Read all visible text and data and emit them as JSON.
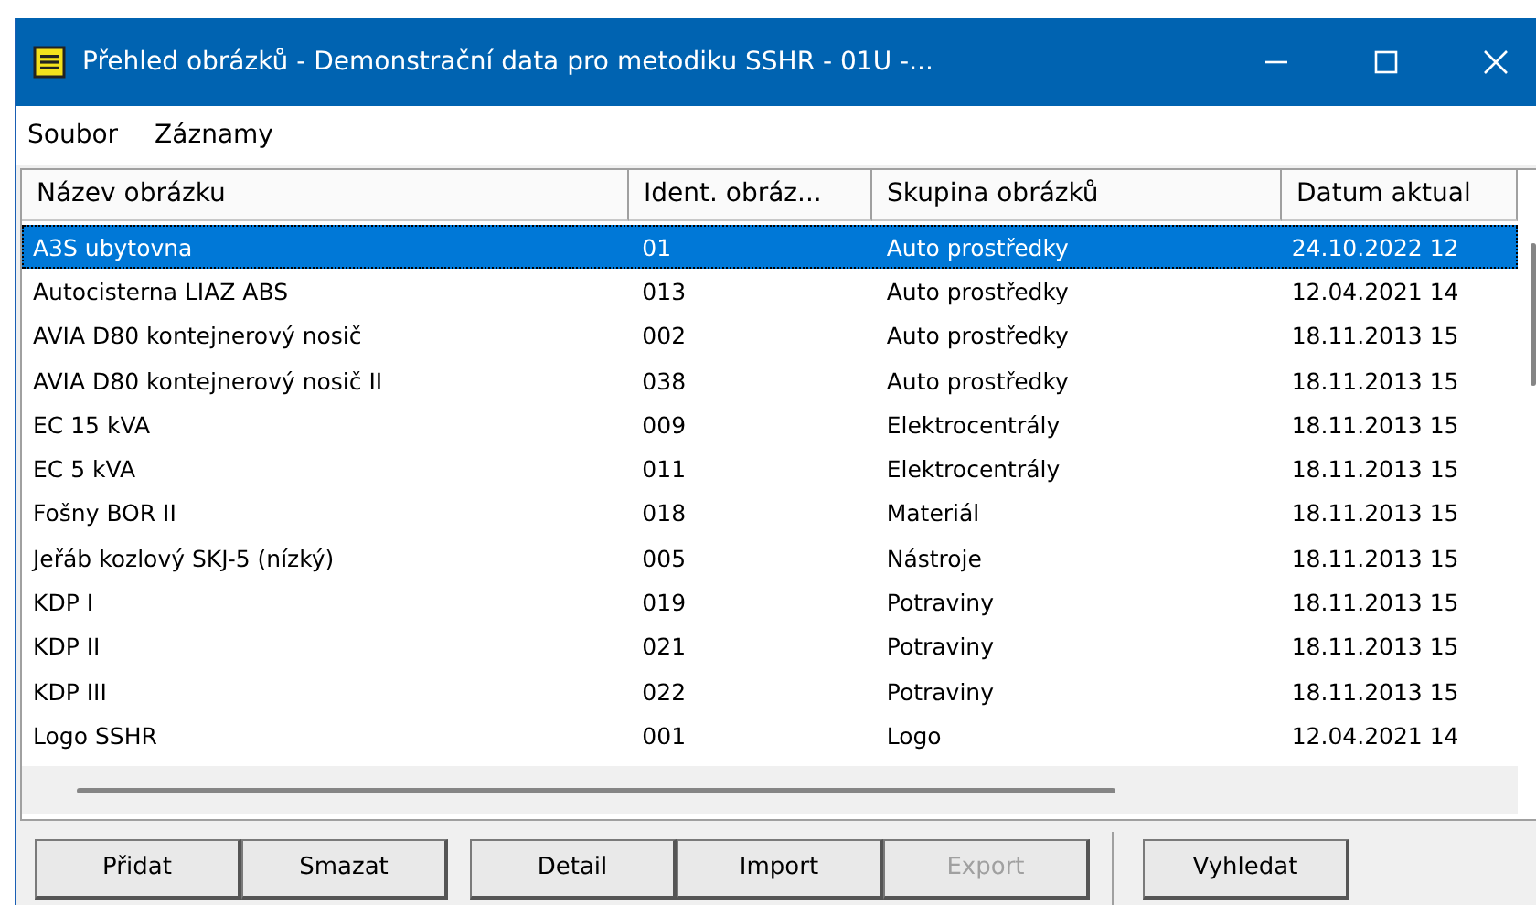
{
  "window": {
    "title": "Přehled obrázků - Demonstrační data pro metodiku SSHR - 01U -..."
  },
  "menu": [
    "Soubor",
    "Záznamy"
  ],
  "table": {
    "columns": [
      "Název obrázku",
      "Ident. obráz...",
      "Skupina obrázků",
      "Datum aktual"
    ],
    "rows": [
      {
        "cells": [
          "A3S ubytovna",
          "01",
          "Auto prostředky",
          "24.10.2022 12"
        ],
        "selected": true
      },
      {
        "cells": [
          "Autocisterna LIAZ ABS",
          "013",
          "Auto prostředky",
          "12.04.2021 14"
        ],
        "selected": false
      },
      {
        "cells": [
          "AVIA D80 kontejnerový nosič",
          "002",
          "Auto prostředky",
          "18.11.2013 15"
        ],
        "selected": false
      },
      {
        "cells": [
          "AVIA D80 kontejnerový nosič II",
          "038",
          "Auto prostředky",
          "18.11.2013 15"
        ],
        "selected": false
      },
      {
        "cells": [
          "EC 15 kVA",
          "009",
          "Elektrocentrály",
          "18.11.2013 15"
        ],
        "selected": false
      },
      {
        "cells": [
          "EC 5 kVA",
          "011",
          "Elektrocentrály",
          "18.11.2013 15"
        ],
        "selected": false
      },
      {
        "cells": [
          "Fošny BOR II",
          "018",
          "Materiál",
          "18.11.2013 15"
        ],
        "selected": false
      },
      {
        "cells": [
          "Jeřáb kozlový SKJ-5 (nízký)",
          "005",
          "Nástroje",
          "18.11.2013 15"
        ],
        "selected": false
      },
      {
        "cells": [
          "KDP I",
          "019",
          "Potraviny",
          "18.11.2013 15"
        ],
        "selected": false
      },
      {
        "cells": [
          "KDP II",
          "021",
          "Potraviny",
          "18.11.2013 15"
        ],
        "selected": false
      },
      {
        "cells": [
          "KDP III",
          "022",
          "Potraviny",
          "18.11.2013 15"
        ],
        "selected": false
      },
      {
        "cells": [
          "Logo SSHR",
          "001",
          "Logo",
          "12.04.2021 14"
        ],
        "selected": false
      }
    ]
  },
  "buttons": [
    {
      "label": "Přidat",
      "disabled": false
    },
    {
      "label": "Smazat",
      "disabled": false
    },
    {
      "label": "Detail",
      "disabled": false
    },
    {
      "label": "Import",
      "disabled": false
    },
    {
      "label": "Export",
      "disabled": true
    },
    {
      "label": "Vyhledat",
      "disabled": false
    }
  ]
}
